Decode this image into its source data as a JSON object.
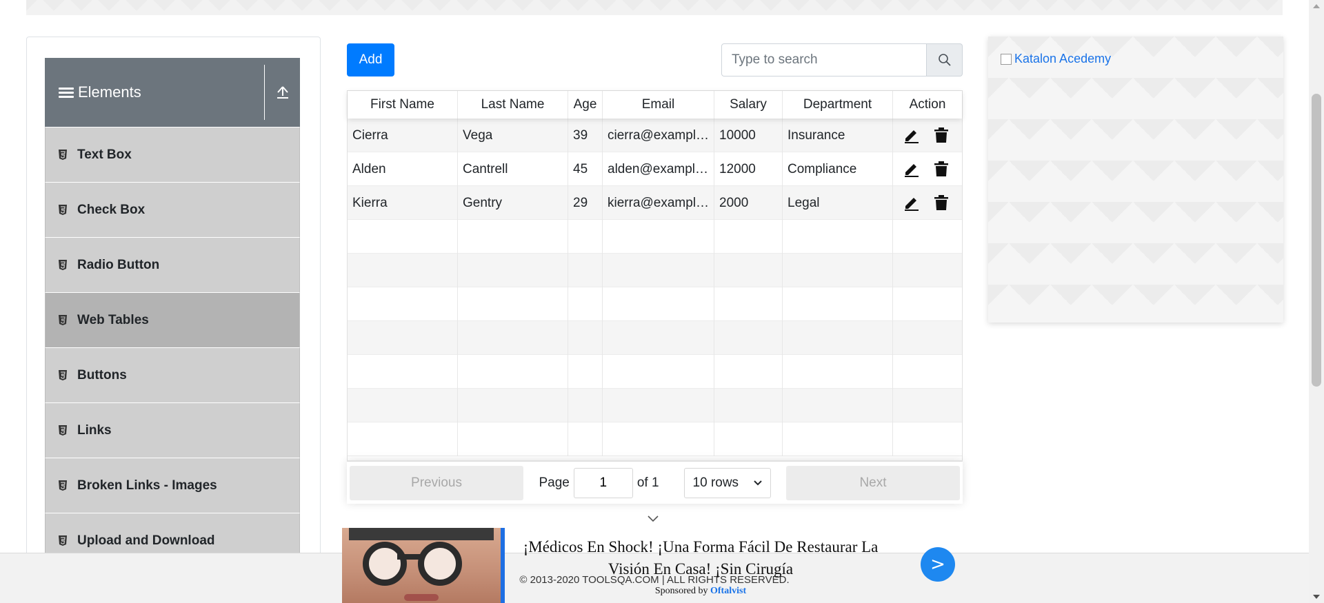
{
  "sidebar": {
    "group_title": "Elements",
    "items": [
      {
        "label": "Text Box"
      },
      {
        "label": "Check Box"
      },
      {
        "label": "Radio Button"
      },
      {
        "label": "Web Tables",
        "active": true
      },
      {
        "label": "Buttons"
      },
      {
        "label": "Links"
      },
      {
        "label": "Broken Links - Images"
      },
      {
        "label": "Upload and Download"
      }
    ]
  },
  "toolbar": {
    "add_label": "Add",
    "search_placeholder": "Type to search"
  },
  "table": {
    "columns": [
      "First Name",
      "Last Name",
      "Age",
      "Email",
      "Salary",
      "Department",
      "Action"
    ],
    "rows": [
      [
        "Cierra",
        "Vega",
        "39",
        "cierra@example.com",
        "10000",
        "Insurance"
      ],
      [
        "Alden",
        "Cantrell",
        "45",
        "alden@example.com",
        "12000",
        "Compliance"
      ],
      [
        "Kierra",
        "Gentry",
        "29",
        "kierra@example.com",
        "2000",
        "Legal"
      ]
    ],
    "empty_rows": 7
  },
  "pagination": {
    "previous_label": "Previous",
    "next_label": "Next",
    "page_label": "Page",
    "current_page": "1",
    "of_label": "of 1",
    "rows_option": "10 rows"
  },
  "right_ad": {
    "alt_text": "Katalon Acedemy"
  },
  "bottom_ad": {
    "headline": "¡Médicos En Shock! ¡Una Forma Fácil De Restaurar La Visión En Casa! ¡Sin Cirugía",
    "sponsored_by": "Sponsored by",
    "sponsor": "Oftalvist",
    "go_label": ">"
  },
  "footer": {
    "text": "© 2013-2020 TOOLSQA.COM | ALL RIGHTS RESERVED."
  },
  "colors": {
    "primary": "#007bff",
    "header_gray": "#6c757d",
    "menu_item": "#cfcfcf",
    "menu_active": "#b3b3b3"
  },
  "icons": {
    "menu": "hamburger-icon",
    "collapse": "upload-arrow-icon",
    "item": "html5-icon",
    "search": "search-icon",
    "edit": "pencil-icon",
    "delete": "trash-icon",
    "dropdown": "chevron-down-icon"
  }
}
